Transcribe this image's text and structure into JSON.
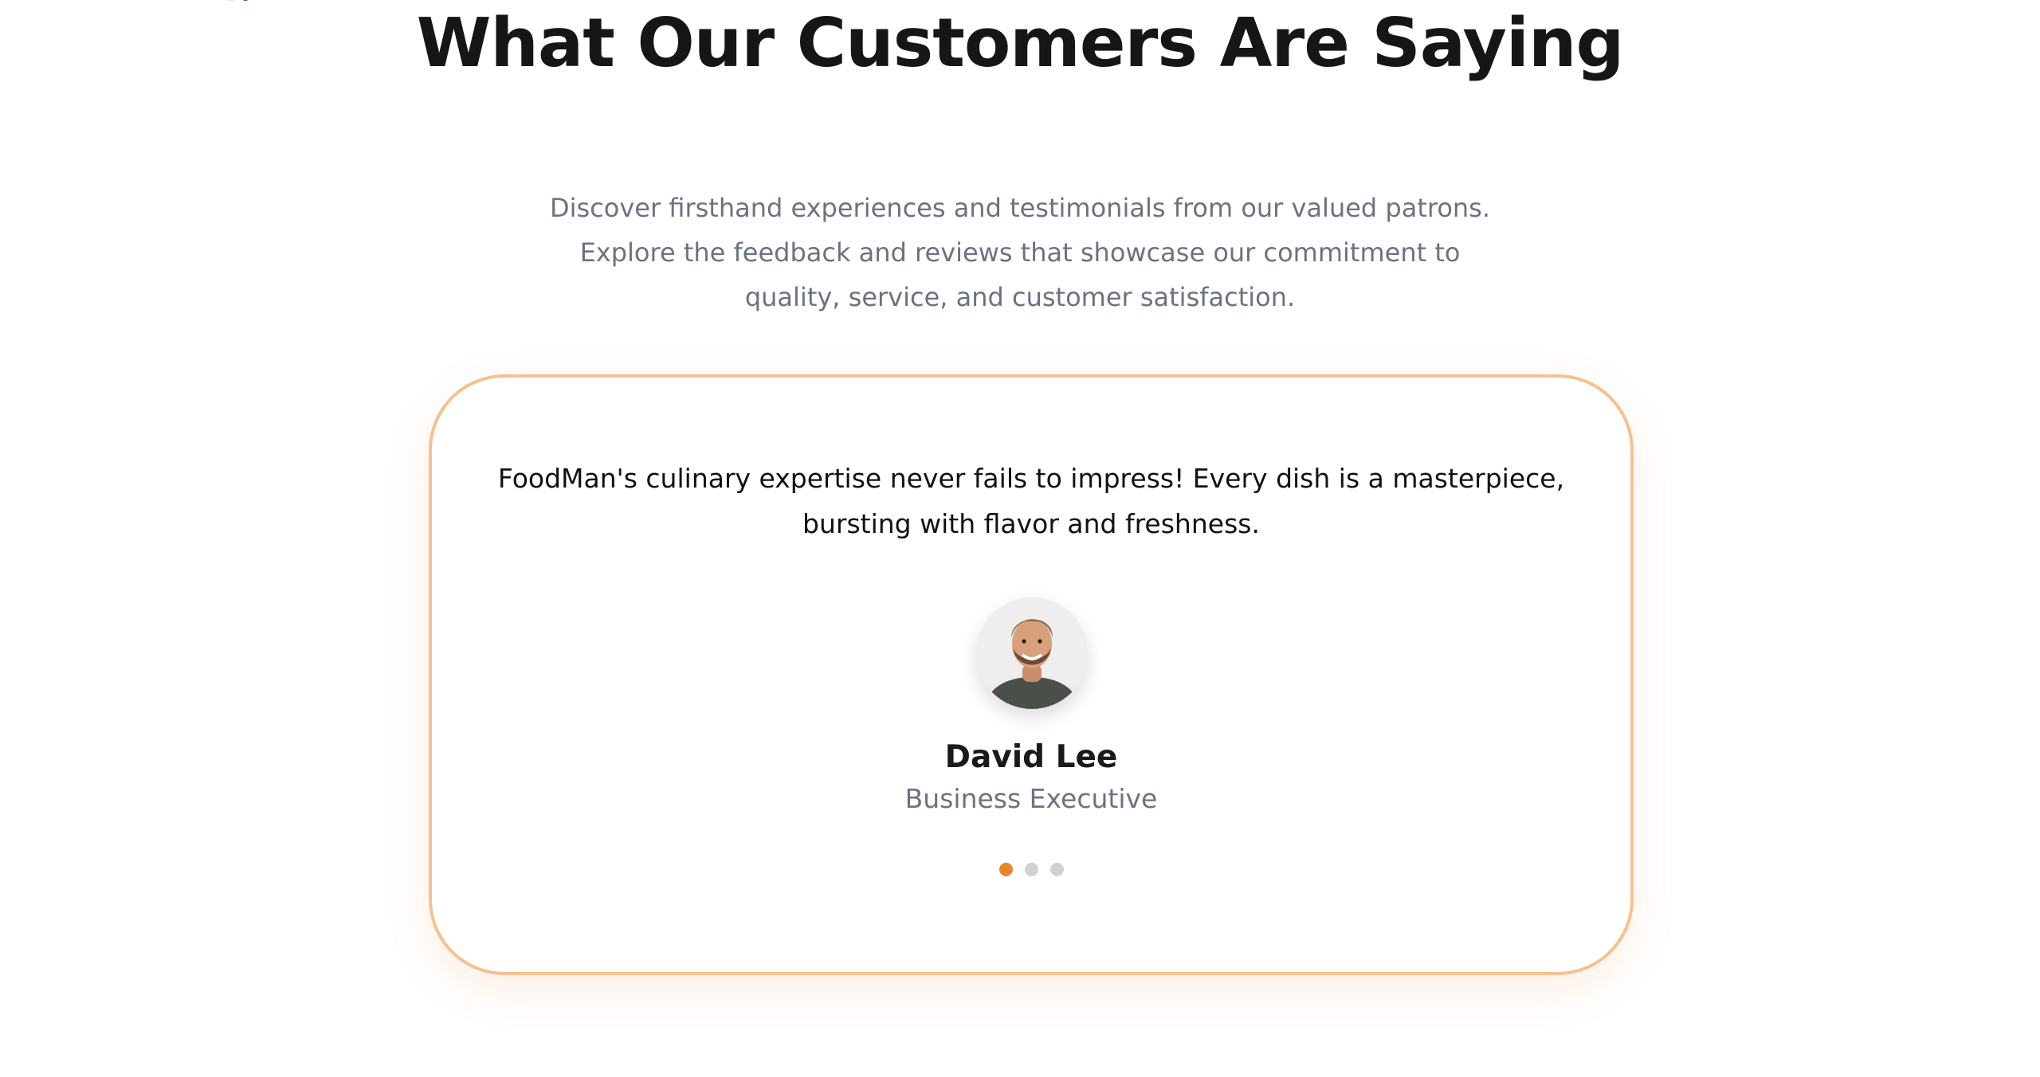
{
  "testimonials": {
    "title": "What Our Customers Are Saying",
    "subtitle": "Discover firsthand experiences and testimonials from our valued patrons. Explore the feedback and reviews that showcase our commitment to quality, service, and customer satisfaction.",
    "current": {
      "quote": "FoodMan's culinary expertise never fails to impress! Every dish is a masterpiece, bursting with flavor and freshness.",
      "name": "David Lee",
      "role": "Business Executive"
    },
    "slide_count": 3,
    "active_slide": 1
  },
  "colors": {
    "accent": "#e8852e",
    "card_border": "#f6c092",
    "heading": "#161616",
    "muted_text": "#6b7280",
    "dot_inactive": "#d1d1d1"
  }
}
